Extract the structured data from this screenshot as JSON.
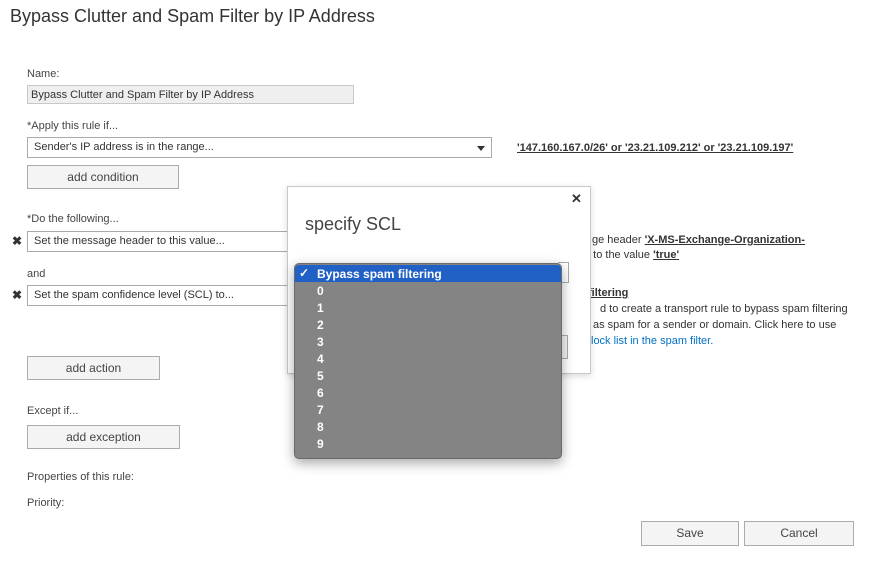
{
  "page": {
    "title": "Bypass Clutter and Spam Filter by IP Address"
  },
  "name_field": {
    "label": "Name:",
    "value": "Bypass Clutter and Spam Filter by IP Address"
  },
  "apply": {
    "label": "*Apply this rule if...",
    "condition": "Sender's IP address is in the range...",
    "condition_value": "'147.160.167.0/26' or '23.21.109.212' or '23.21.109.197'",
    "add_condition": "add condition"
  },
  "actions": {
    "label": "*Do the following...",
    "action1": "Set the message header to this value...",
    "action1_desc_prefix": "ge header",
    "action1_header": "'X-MS-Exchange-Organization-",
    "action1_desc_mid": "' to the value",
    "action1_value": "'true'",
    "and_label": "and",
    "action2": "Set the spam confidence level (SCL) to...",
    "action2_link": "filtering",
    "action2_line1": "d to create a transport rule to bypass spam filtering",
    "action2_line2": "as spam for a sender or domain. Click here to use",
    "action2_line3": "lock list in the spam filter.",
    "add_action": "add action"
  },
  "except": {
    "label": "Except if...",
    "add_exception": "add exception"
  },
  "properties": {
    "label": "Properties of this rule:",
    "priority": "Priority:"
  },
  "footer": {
    "save": "Save",
    "cancel": "Cancel"
  },
  "dialog": {
    "title": "specify SCL",
    "close": "✕",
    "options": [
      "Bypass spam filtering",
      "0",
      "1",
      "2",
      "3",
      "4",
      "5",
      "6",
      "7",
      "8",
      "9"
    ],
    "selected_index": 0,
    "checkmark": "✓"
  },
  "colors": {
    "accent": "#0072c6",
    "selection": "#2160c4",
    "menu_bg": "#848484"
  }
}
